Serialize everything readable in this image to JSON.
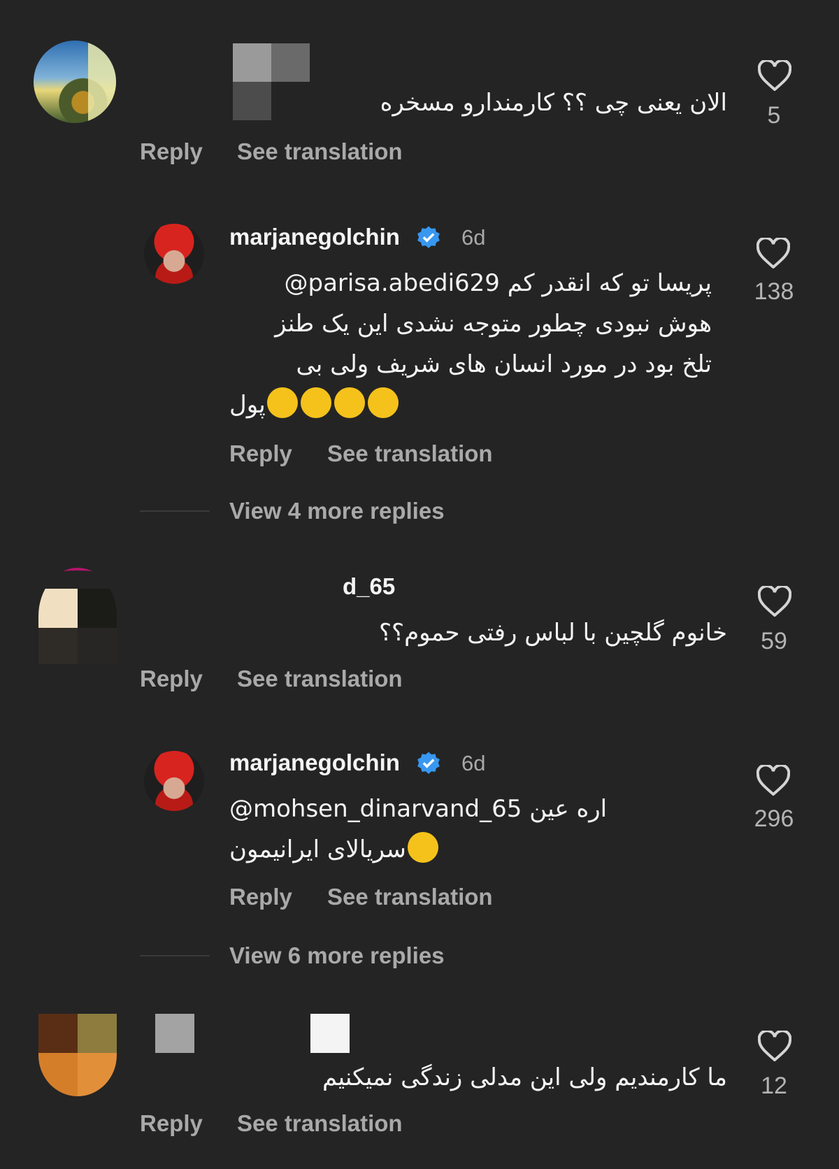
{
  "comments": [
    {
      "username": "",
      "text": "الان یعنی چی ؟؟ کارمندارو مسخره",
      "likes": "5",
      "reply_label": "Reply",
      "translate_label": "See translation"
    },
    {
      "username": "marjanegolchin",
      "time": "6d",
      "text_lines": [
        "@parisa.abedi629 پریسا تو که انقدر کم",
        "هوش نبودی چطور متوجه نشدی این یک طنز",
        "تلخ بود در مورد انسان های شریف ولی بی",
        "پول"
      ],
      "likes": "138",
      "reply_label": "Reply",
      "translate_label": "See translation",
      "view_more": "View 4 more replies"
    },
    {
      "username": "d_65",
      "text": "خانوم گلچین با لباس رفتی حموم؟؟",
      "likes": "59",
      "reply_label": "Reply",
      "translate_label": "See translation"
    },
    {
      "username": "marjanegolchin",
      "time": "6d",
      "text_lines": [
        "@mohsen_dinarvand_65 اره عین",
        "سریالای ایرانیمون"
      ],
      "likes": "296",
      "reply_label": "Reply",
      "translate_label": "See translation",
      "view_more": "View 6 more replies"
    },
    {
      "username": "",
      "text": "ما کارمندیم ولی این مدلی زندگی نمیکنیم",
      "likes": "12",
      "reply_label": "Reply",
      "translate_label": "See translation"
    }
  ],
  "icons": {
    "like": "heart-outline-icon",
    "verified": "verified-badge-icon"
  },
  "colors": {
    "background": "#242424",
    "verified": "#3897f0",
    "secondary_text": "#a9a9a9"
  }
}
